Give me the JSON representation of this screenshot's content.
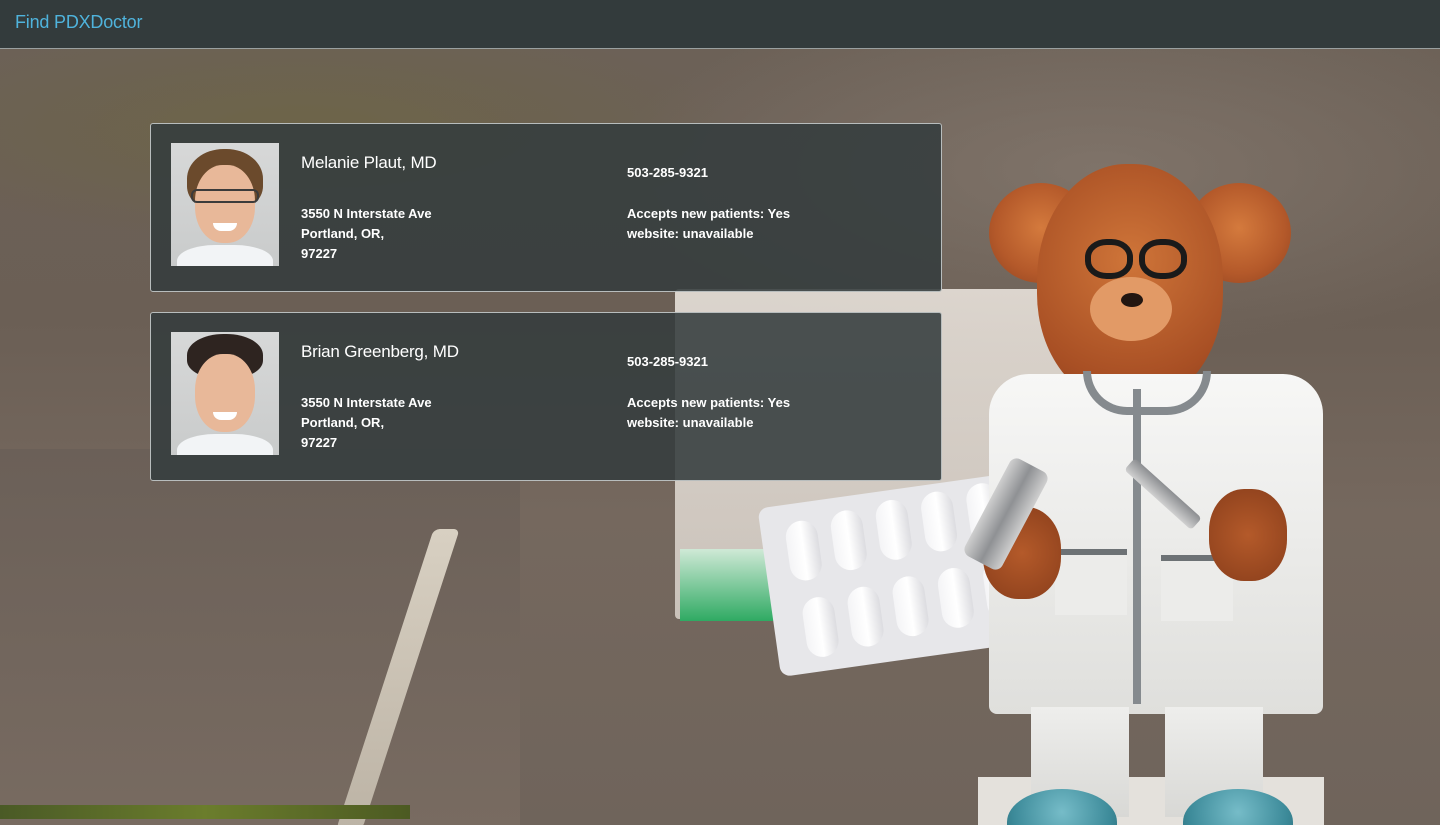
{
  "navbar": {
    "brand": "Find PDXDoctor",
    "brand_color": "#4fb3dc"
  },
  "doctors": [
    {
      "name": "Melanie Plaut, MD",
      "address_line1": "3550 N Interstate Ave",
      "address_line2": "Portland, OR,",
      "address_line3": "97227",
      "phone": "503-285-9321",
      "accepts_new_patients": "Accepts new patients: Yes",
      "website": "website: unavailable",
      "photo_icon": "doctor-photo-female"
    },
    {
      "name": "Brian Greenberg, MD",
      "address_line1": "3550 N Interstate Ave",
      "address_line2": "Portland, OR,",
      "address_line3": "97227",
      "phone": "503-285-9321",
      "accepts_new_patients": "Accepts new patients: Yes",
      "website": "website: unavailable",
      "photo_icon": "doctor-photo-male"
    }
  ]
}
